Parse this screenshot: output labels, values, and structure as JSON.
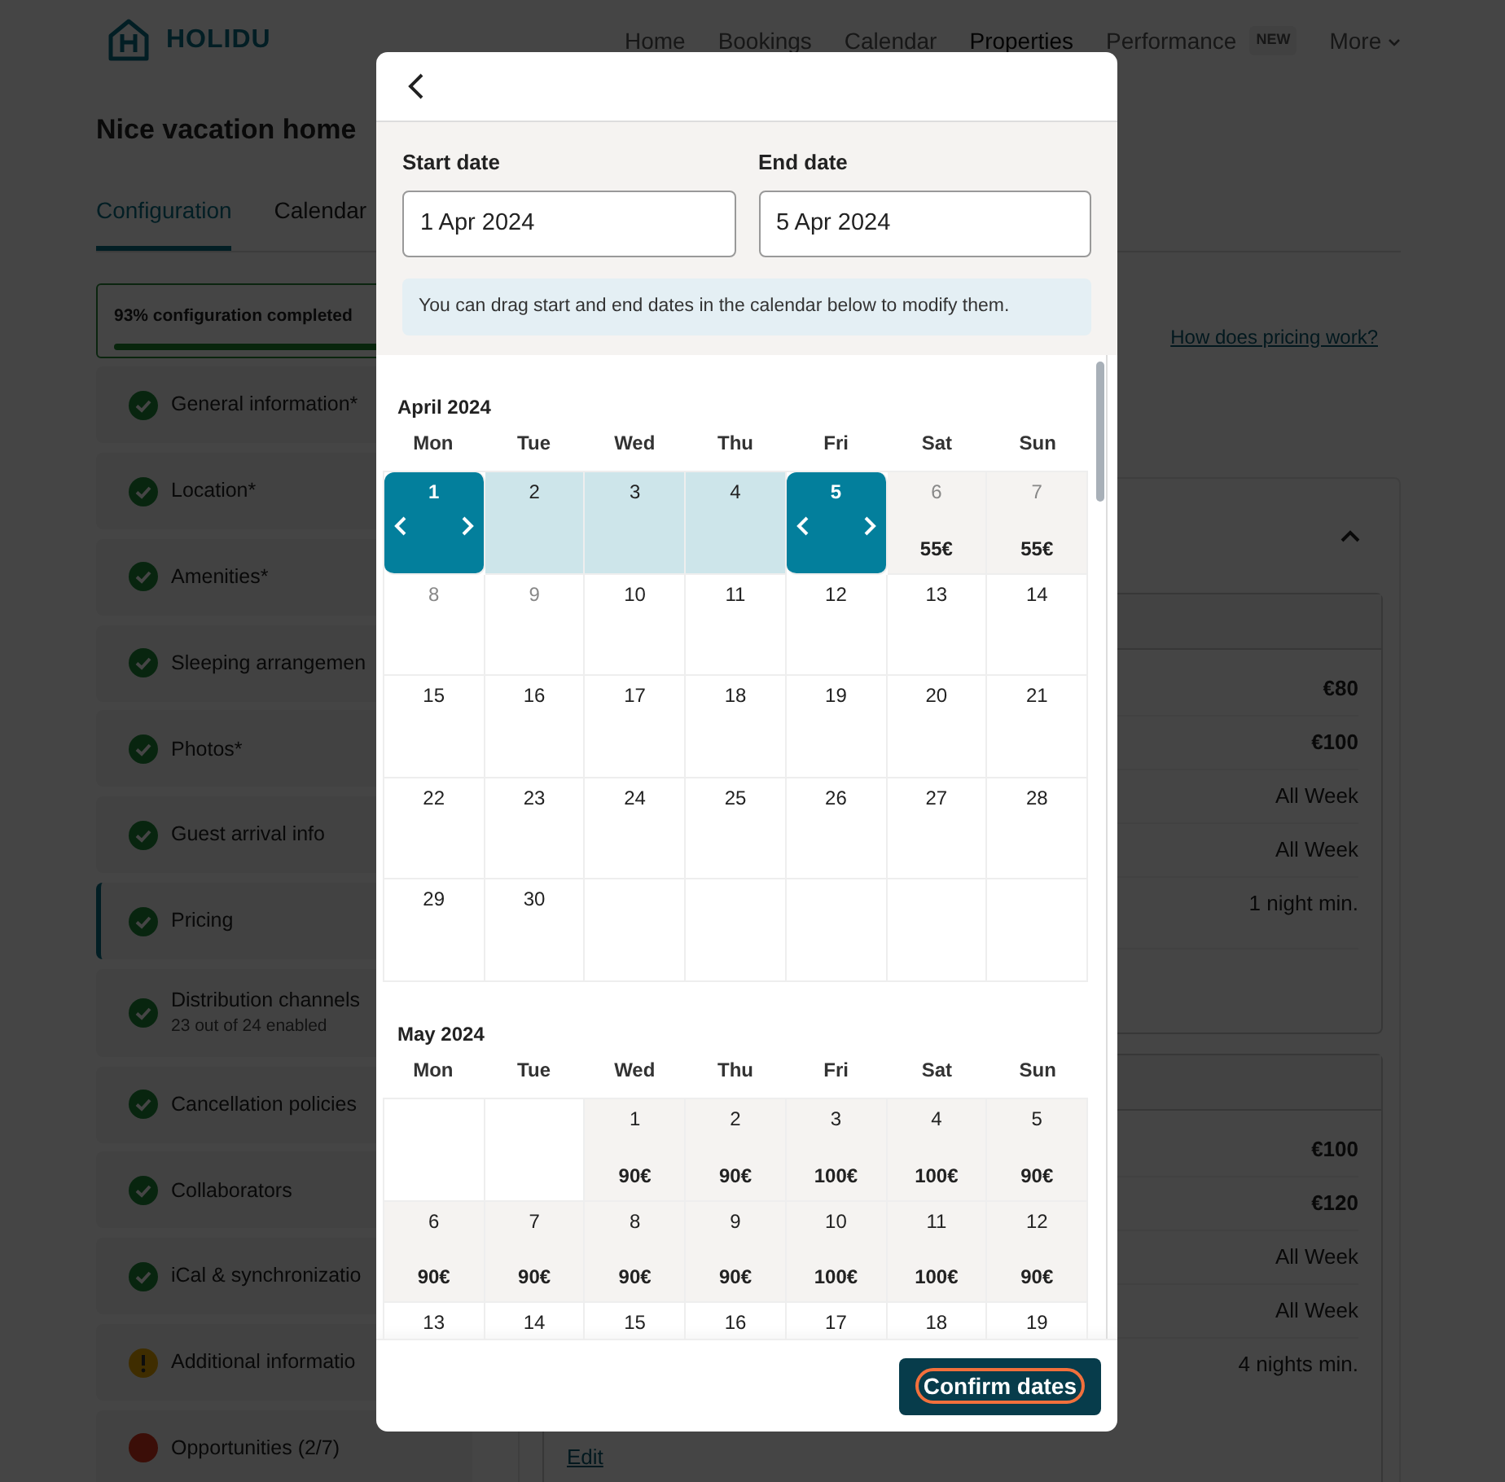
{
  "header": {
    "logo": "HOLIDU",
    "nav": [
      {
        "label": "Home",
        "selected": false,
        "dropdown": false
      },
      {
        "label": "Bookings",
        "selected": false,
        "dropdown": false
      },
      {
        "label": "Calendar",
        "selected": false,
        "dropdown": false
      },
      {
        "label": "Properties",
        "selected": true,
        "dropdown": false
      },
      {
        "label": "Performance",
        "selected": false,
        "dropdown": false,
        "badge": "NEW"
      },
      {
        "label": "More",
        "selected": false,
        "dropdown": true
      }
    ]
  },
  "page_title": "Nice vacation home",
  "tabs": [
    {
      "label": "Configuration",
      "selected": true
    },
    {
      "label": "Calendar",
      "selected": false
    }
  ],
  "progress": {
    "label": "93% configuration completed",
    "level": 0.93
  },
  "sidebar": {
    "items": [
      {
        "label": "General information*",
        "kind": "done",
        "selected": false
      },
      {
        "label": "Location*",
        "kind": "done",
        "selected": false
      },
      {
        "label": "Amenities*",
        "kind": "done",
        "selected": false
      },
      {
        "label": "Sleeping arrangemen",
        "kind": "done",
        "selected": false
      },
      {
        "label": "Photos*",
        "kind": "done",
        "selected": false
      },
      {
        "label": "Guest arrival info",
        "kind": "done",
        "selected": false
      },
      {
        "label": "Pricing",
        "kind": "done",
        "selected": true
      },
      {
        "label": "Distribution channels",
        "subtitle": "23 out of 24 enabled",
        "kind": "done",
        "selected": false
      },
      {
        "label": "Cancellation policies",
        "kind": "done",
        "selected": false
      },
      {
        "label": "Collaborators",
        "kind": "done",
        "selected": false
      },
      {
        "label": "iCal & synchronizatio",
        "kind": "done",
        "selected": false
      },
      {
        "label": "Additional informatio",
        "kind": "warning",
        "selected": false
      },
      {
        "label": "Opportunities (2/7)",
        "kind": "error",
        "selected": false
      }
    ]
  },
  "pricing": {
    "help_link": "How does pricing work?",
    "expanded": true,
    "rate_cards": [
      {
        "rows": [
          {
            "kind": "price",
            "value": "€80"
          },
          {
            "kind": "price",
            "value": "€100"
          },
          {
            "kind": "rule",
            "value": "All Week"
          },
          {
            "kind": "rule",
            "value": "All Week"
          },
          {
            "kind": "rule",
            "value": "1 night min."
          }
        ]
      },
      {
        "rows": [
          {
            "kind": "price",
            "value": "€100"
          },
          {
            "kind": "price",
            "value": "€120"
          },
          {
            "kind": "rule",
            "value": "All Week"
          },
          {
            "kind": "rule",
            "value": "All Week"
          },
          {
            "kind": "rule",
            "value": "4 nights min."
          }
        ],
        "edit_link": "Edit"
      }
    ]
  },
  "modal": {
    "start_date": {
      "label": "Start date",
      "value": "1 Apr 2024"
    },
    "end_date": {
      "label": "End date",
      "value": "5 Apr 2024"
    },
    "hint": "You can drag start and end dates in the calendar below to modify them.",
    "months": [
      {
        "title": "April 2024",
        "weekdays": [
          "Mon",
          "Tue",
          "Wed",
          "Thu",
          "Fri",
          "Sat",
          "Sun"
        ],
        "weeks": [
          [
            {
              "kind": "endpoint",
              "day": "1",
              "muted": false
            },
            {
              "kind": "range",
              "day": "2",
              "muted": false
            },
            {
              "kind": "range",
              "day": "3",
              "muted": false
            },
            {
              "kind": "range",
              "day": "4",
              "muted": false
            },
            {
              "kind": "endpoint",
              "day": "5",
              "muted": false
            },
            {
              "kind": "priced",
              "day": "6",
              "price": "55€",
              "muted": true
            },
            {
              "kind": "priced",
              "day": "7",
              "price": "55€",
              "muted": true
            }
          ],
          [
            {
              "kind": "plain",
              "day": "8",
              "muted": true
            },
            {
              "kind": "plain",
              "day": "9",
              "muted": true
            },
            {
              "kind": "plain",
              "day": "10",
              "muted": false
            },
            {
              "kind": "plain",
              "day": "11",
              "muted": false
            },
            {
              "kind": "plain",
              "day": "12",
              "muted": false
            },
            {
              "kind": "plain",
              "day": "13",
              "muted": false
            },
            {
              "kind": "plain",
              "day": "14",
              "muted": false
            }
          ],
          [
            {
              "kind": "plain",
              "day": "15",
              "muted": false
            },
            {
              "kind": "plain",
              "day": "16",
              "muted": false
            },
            {
              "kind": "plain",
              "day": "17",
              "muted": false
            },
            {
              "kind": "plain",
              "day": "18",
              "muted": false
            },
            {
              "kind": "plain",
              "day": "19",
              "muted": false
            },
            {
              "kind": "plain",
              "day": "20",
              "muted": false
            },
            {
              "kind": "plain",
              "day": "21",
              "muted": false
            }
          ],
          [
            {
              "kind": "plain",
              "day": "22",
              "muted": false
            },
            {
              "kind": "plain",
              "day": "23",
              "muted": false
            },
            {
              "kind": "plain",
              "day": "24",
              "muted": false
            },
            {
              "kind": "plain",
              "day": "25",
              "muted": false
            },
            {
              "kind": "plain",
              "day": "26",
              "muted": false
            },
            {
              "kind": "plain",
              "day": "27",
              "muted": false
            },
            {
              "kind": "plain",
              "day": "28",
              "muted": false
            }
          ],
          [
            {
              "kind": "plain",
              "day": "29",
              "muted": false
            },
            {
              "kind": "plain",
              "day": "30",
              "muted": false
            },
            {
              "kind": "empty"
            },
            {
              "kind": "empty"
            },
            {
              "kind": "empty"
            },
            {
              "kind": "empty"
            },
            {
              "kind": "empty"
            }
          ]
        ]
      },
      {
        "title": "May 2024",
        "weekdays": [
          "Mon",
          "Tue",
          "Wed",
          "Thu",
          "Fri",
          "Sat",
          "Sun"
        ],
        "weeks": [
          [
            {
              "kind": "empty"
            },
            {
              "kind": "empty"
            },
            {
              "kind": "priced",
              "day": "1",
              "price": "90€",
              "muted": false
            },
            {
              "kind": "priced",
              "day": "2",
              "price": "90€",
              "muted": false
            },
            {
              "kind": "priced",
              "day": "3",
              "price": "100€",
              "muted": false
            },
            {
              "kind": "priced",
              "day": "4",
              "price": "100€",
              "muted": false
            },
            {
              "kind": "priced",
              "day": "5",
              "price": "90€",
              "muted": false
            }
          ],
          [
            {
              "kind": "priced",
              "day": "6",
              "price": "90€",
              "muted": false
            },
            {
              "kind": "priced",
              "day": "7",
              "price": "90€",
              "muted": false
            },
            {
              "kind": "priced",
              "day": "8",
              "price": "90€",
              "muted": false
            },
            {
              "kind": "priced",
              "day": "9",
              "price": "90€",
              "muted": false
            },
            {
              "kind": "priced",
              "day": "10",
              "price": "100€",
              "muted": false
            },
            {
              "kind": "priced",
              "day": "11",
              "price": "100€",
              "muted": false
            },
            {
              "kind": "priced",
              "day": "12",
              "price": "90€",
              "muted": false
            }
          ],
          [
            {
              "kind": "plain",
              "day": "13",
              "muted": false
            },
            {
              "kind": "plain",
              "day": "14",
              "muted": false
            },
            {
              "kind": "plain",
              "day": "15",
              "muted": false
            },
            {
              "kind": "plain",
              "day": "16",
              "muted": false
            },
            {
              "kind": "plain",
              "day": "17",
              "muted": false
            },
            {
              "kind": "plain",
              "day": "18",
              "muted": false
            },
            {
              "kind": "plain",
              "day": "19",
              "muted": false
            }
          ]
        ]
      }
    ],
    "confirm_button": "Confirm dates"
  }
}
